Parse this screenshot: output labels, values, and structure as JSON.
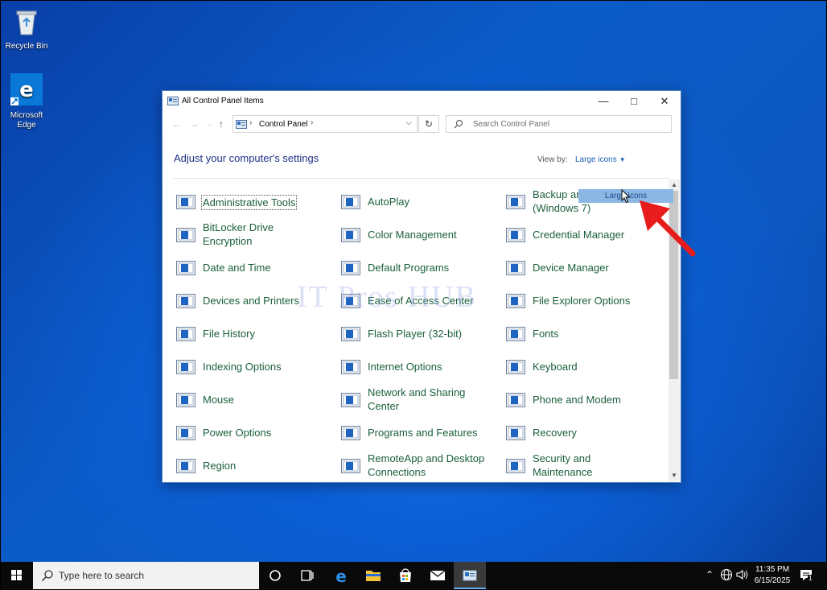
{
  "desktop": {
    "icons": [
      {
        "label": "Recycle Bin"
      },
      {
        "label": "Microsoft Edge"
      }
    ]
  },
  "window": {
    "title": "All Control Panel Items",
    "address": {
      "crumb": "Control Panel"
    },
    "search_placeholder": "Search Control Panel",
    "header": "Adjust your computer's settings",
    "view_by_label": "View by:",
    "view_by_value": "Large icons",
    "tooltip": "Large Icons",
    "items": [
      [
        "Administrative Tools",
        "AutoPlay",
        "Backup and Restore (Windows 7)"
      ],
      [
        "BitLocker Drive Encryption",
        "Color Management",
        "Credential Manager"
      ],
      [
        "Date and Time",
        "Default Programs",
        "Device Manager"
      ],
      [
        "Devices and Printers",
        "Ease of Access Center",
        "File Explorer Options"
      ],
      [
        "File History",
        "Flash Player (32-bit)",
        "Fonts"
      ],
      [
        "Indexing Options",
        "Internet Options",
        "Keyboard"
      ],
      [
        "Mouse",
        "Network and Sharing Center",
        "Phone and Modem"
      ],
      [
        "Power Options",
        "Programs and Features",
        "Recovery"
      ],
      [
        "Region",
        "RemoteApp and Desktop Connections",
        "Security and Maintenance"
      ]
    ]
  },
  "watermark": "IT Pros HUB",
  "taskbar": {
    "search_placeholder": "Type here to search",
    "time": "11:35 PM",
    "date": "6/15/2025",
    "notification_count": "1"
  },
  "colors": {
    "accent": "#1a5fb4",
    "link_green": "#1a5f3a",
    "header_blue": "#1e3287",
    "annotation_red": "#e81c1c"
  }
}
